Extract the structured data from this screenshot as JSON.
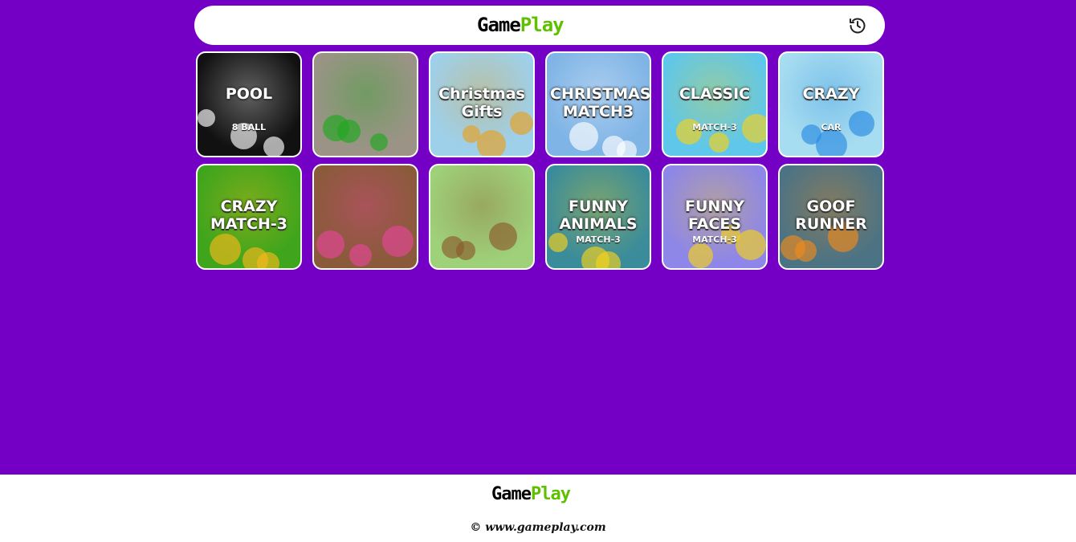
{
  "header": {
    "logo": {
      "part1": "Game",
      "part2": "Play"
    },
    "history_icon": "history-clock-icon"
  },
  "games": [
    {
      "id": "pool-8-ball",
      "title": "POOL",
      "subtitle": "8 BALL",
      "bg": "#111111",
      "accent": "#ffffff"
    },
    {
      "id": "traffic-light",
      "title": "",
      "subtitle": "",
      "bg": "#9b9486",
      "accent": "#1ea81e"
    },
    {
      "id": "christmas-gifts",
      "title": "Christmas Gifts",
      "subtitle": "",
      "bg": "#9ed0ea",
      "accent": "#e8a020"
    },
    {
      "id": "christmas-match3",
      "title": "CHRISTMAS MATCH3",
      "subtitle": "",
      "bg": "#7fb4e6",
      "accent": "#ffffff"
    },
    {
      "id": "classic-match3",
      "title": "CLASSIC",
      "subtitle": "MATCH-3",
      "bg": "#5fc7ea",
      "accent": "#f6d21b"
    },
    {
      "id": "crazy-car",
      "title": "CRAZY",
      "subtitle": "CAR",
      "bg": "#a7ddf0",
      "accent": "#2a8be0"
    },
    {
      "id": "crazy-match3",
      "title": "CRAZY MATCH-3",
      "subtitle": "",
      "bg": "#3fa51c",
      "accent": "#f6b81b"
    },
    {
      "id": "donuts",
      "title": "",
      "subtitle": "",
      "bg": "#8a5a3a",
      "accent": "#e6469a"
    },
    {
      "id": "beavers",
      "title": "",
      "subtitle": "",
      "bg": "#9fd07a",
      "accent": "#8b5a2b"
    },
    {
      "id": "funny-animals-match3",
      "title": "FUNNY ANIMALS",
      "subtitle": "MATCH-3",
      "bg": "#3b8c9a",
      "accent": "#f6d21b"
    },
    {
      "id": "funny-faces-match3",
      "title": "FUNNY FACES",
      "subtitle": "MATCH-3",
      "bg": "#8e86e8",
      "accent": "#f6d21b"
    },
    {
      "id": "goof-runner",
      "title": "GOOF RUNNER",
      "subtitle": "",
      "bg": "#4c7384",
      "accent": "#f08a1b"
    }
  ],
  "footer": {
    "logo": {
      "part1": "Game",
      "part2": "Play"
    },
    "copyright": "© www.gameplay.com"
  },
  "colors": {
    "background": "#7400c6",
    "logo_dark": "#000000",
    "logo_green": "#5fc000",
    "surface": "#ffffff"
  }
}
